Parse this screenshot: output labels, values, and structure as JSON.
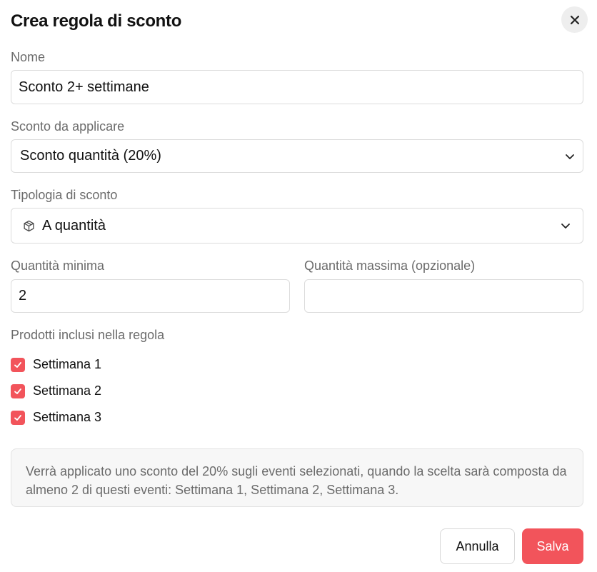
{
  "dialog": {
    "title": "Crea regola di sconto"
  },
  "fields": {
    "name": {
      "label": "Nome",
      "value": "Sconto 2+ settimane"
    },
    "discount": {
      "label": "Sconto da applicare",
      "value": "Sconto quantità (20%)"
    },
    "type": {
      "label": "Tipologia di sconto",
      "value": "A quantità",
      "icon": "box-icon"
    },
    "min_qty": {
      "label": "Quantità minima",
      "value": "2"
    },
    "max_qty": {
      "label": "Quantità massima (opzionale)",
      "value": ""
    }
  },
  "products": {
    "label": "Prodotti inclusi nella regola",
    "items": [
      {
        "label": "Settimana 1",
        "checked": true
      },
      {
        "label": "Settimana 2",
        "checked": true
      },
      {
        "label": "Settimana 3",
        "checked": true
      }
    ]
  },
  "info": {
    "text": "Verrà applicato uno sconto del 20% sugli eventi selezionati, quando la scelta sarà composta da almeno 2 di questi eventi: Settimana 1, Settimana 2, Settimana 3."
  },
  "actions": {
    "cancel": "Annulla",
    "save": "Salva"
  },
  "colors": {
    "accent": "#f2545b",
    "muted_text": "#6b6b6b",
    "border": "#dcdcdc"
  }
}
